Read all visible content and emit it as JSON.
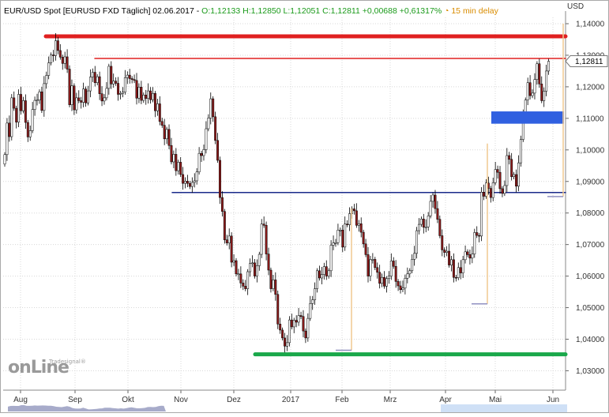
{
  "header": {
    "instrument": "EUR/USD Spot [EURUSD FXD Täglich] 02.06.2017 -",
    "ohlc_text": "O:1,12133 H:1,12850 L:1,12051 C:1,12811 +0,00688 +0,61317%",
    "delay_icon": "clock-icon",
    "delay_text": "15 min delay"
  },
  "unit": "USD",
  "logo": {
    "brand": "onLine",
    "sub": "Tradesignal®"
  },
  "colors": {
    "candle_up": "#ffffff",
    "candle_down": "#8b1a1a",
    "wick": "#000000",
    "resistance_red": "#e02020",
    "support_blue": "#1a2a8a",
    "support_green": "#1aa84a",
    "zone_blue": "#3060e0",
    "orange_marker": "#f0c890",
    "grid": "#d8d8d8",
    "last_price_marker": "#ff2a2a"
  },
  "chart_data": {
    "type": "candlestick",
    "title": "EUR/USD Spot [EURUSD FXD Täglich]",
    "ylabel": "USD",
    "ylim": [
      1.0245,
      1.1465
    ],
    "y_ticks": [
      "1,14000",
      "1,13000",
      "1,12000",
      "1,11000",
      "1,10000",
      "1,09000",
      "1,08000",
      "1,07000",
      "1,06000",
      "1,05000",
      "1,04000",
      "1,03000"
    ],
    "x_ticks": [
      "Aug",
      "Sep",
      "Okt",
      "Nov",
      "Dez",
      "2017",
      "Feb",
      "Mrz",
      "Apr",
      "Mai",
      "Jun"
    ],
    "last_price": "1,12811",
    "grid": true,
    "close_series": [
      1.0985,
      1.1085,
      1.1042,
      1.1165,
      1.1132,
      1.1088,
      1.1176,
      1.1124,
      1.1156,
      1.1087,
      1.1041,
      1.1061,
      1.1128,
      1.1157,
      1.1158,
      1.1184,
      1.1125,
      1.121,
      1.1236,
      1.1276,
      1.1301,
      1.1299,
      1.1346,
      1.1315,
      1.1294,
      1.1274,
      1.1295,
      1.1256,
      1.1143,
      1.1203,
      1.1127,
      1.1165,
      1.1156,
      1.1151,
      1.1193,
      1.1149,
      1.1187,
      1.1231,
      1.1246,
      1.1213,
      1.1232,
      1.1178,
      1.1155,
      1.1165,
      1.1195,
      1.1265,
      1.1209,
      1.1218,
      1.1211,
      1.1176,
      1.1179,
      1.1183,
      1.1229,
      1.1237,
      1.1226,
      1.1223,
      1.122,
      1.1164,
      1.1199,
      1.1157,
      1.1174,
      1.1163,
      1.1187,
      1.1159,
      1.1179,
      1.1124,
      1.1146,
      1.109,
      1.1078,
      1.1035,
      1.1065,
      1.1014,
      1.0962,
      1.0986,
      1.0934,
      1.0961,
      1.0922,
      1.0894,
      1.0901,
      1.0894,
      1.0884,
      1.0897,
      1.0902,
      1.093,
      1.0989,
      1.0982,
      1.1001,
      1.1067,
      1.1101,
      1.1162,
      1.1105,
      1.103,
      1.0967,
      1.0849,
      1.0805,
      1.0715,
      1.0705,
      1.0727,
      1.0644,
      1.0649,
      1.0607,
      1.0607,
      1.0578,
      1.0568,
      1.056,
      1.0614,
      1.064,
      1.0642,
      1.06,
      1.0633,
      1.0669,
      1.0765,
      1.0761,
      1.067,
      1.0619,
      1.056,
      1.0588,
      1.0542,
      1.0448,
      1.0429,
      1.0404,
      1.0378,
      1.0389,
      1.0461,
      1.0439,
      1.046,
      1.0454,
      1.0475,
      1.0472,
      1.0426,
      1.0404,
      1.0466,
      1.0513,
      1.0525,
      1.056,
      1.0617,
      1.0594,
      1.0605,
      1.063,
      1.06,
      1.0617,
      1.0698,
      1.0705,
      1.0706,
      1.0746,
      1.0746,
      1.0692,
      1.0765,
      1.0763,
      1.0798,
      1.0813,
      1.0807,
      1.0761,
      1.0766,
      1.0739,
      1.0702,
      1.0668,
      1.06,
      1.0652,
      1.0653,
      1.0627,
      1.0612,
      1.0577,
      1.0596,
      1.0568,
      1.0592,
      1.06,
      1.0648,
      1.0631,
      1.0583,
      1.0569,
      1.0557,
      1.0562,
      1.0593,
      1.0607,
      1.0617,
      1.0653,
      1.0672,
      1.0744,
      1.0764,
      1.0781,
      1.0755,
      1.0756,
      1.0791,
      1.0837,
      1.0857,
      1.0814,
      1.078,
      1.0728,
      1.0683,
      1.0675,
      1.0679,
      1.0635,
      1.0652,
      1.0596,
      1.0595,
      1.0627,
      1.061,
      1.0652,
      1.0677,
      1.0668,
      1.0657,
      1.067,
      1.0738,
      1.0729,
      1.0727,
      1.0866,
      1.0853,
      1.0895,
      1.0878,
      1.0849,
      1.0896,
      1.0938,
      1.0929,
      1.0877,
      1.0862,
      1.0887,
      1.0982,
      1.097,
      1.0915,
      1.0922,
      1.0885,
      1.0959,
      1.1033,
      1.1108,
      1.1158,
      1.1213,
      1.1172,
      1.118,
      1.1223,
      1.1273,
      1.1209,
      1.1156,
      1.1186,
      1.125,
      1.1281
    ],
    "levels": [
      {
        "kind": "resistance",
        "value": 1.136,
        "color": "#e02020",
        "from": "Aug",
        "to": "Jun"
      },
      {
        "kind": "resistance",
        "value": 1.129,
        "color": "#e02020",
        "from": "Sep",
        "to": "Jun"
      },
      {
        "kind": "support",
        "value": 1.0865,
        "color": "#1a2a8a",
        "from": "Nov",
        "to": "Jun"
      },
      {
        "kind": "support",
        "value": 1.0352,
        "color": "#1aa84a",
        "from": "Dez",
        "to": "Jun"
      }
    ],
    "zone": {
      "from": 1.1122,
      "to": 1.1083,
      "color": "#3060e0"
    }
  }
}
